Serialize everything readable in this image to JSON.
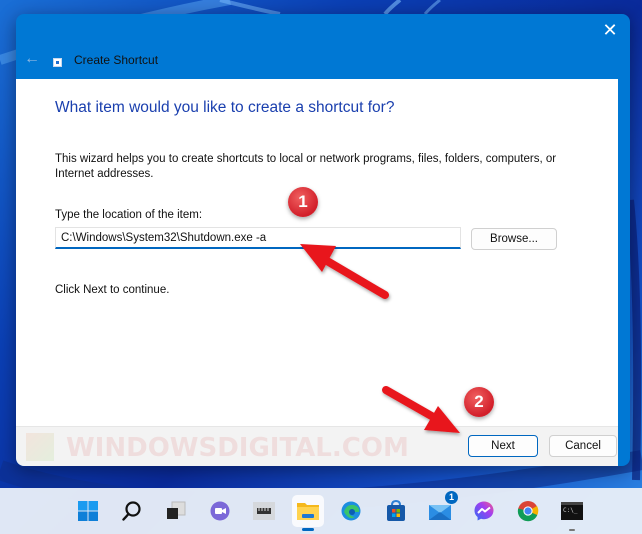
{
  "dialog": {
    "title": "Create Shortcut",
    "close_glyph": "✕",
    "back_glyph": "←",
    "heading": "What item would you like to create a shortcut for?",
    "description": "This wizard helps you to create shortcuts to local or network programs, files, folders, computers, or Internet addresses.",
    "location_label": "Type the location of the item:",
    "location_value": "C:\\Windows\\System32\\Shutdown.exe -a",
    "browse_label": "Browse...",
    "continue_text": "Click Next to continue.",
    "next_label": "Next",
    "cancel_label": "Cancel",
    "accent_color": "#0078d4",
    "heading_color": "#1a3fae"
  },
  "annotations": {
    "callout_1": "1",
    "callout_2": "2",
    "arrow_color": "#e8141c",
    "watermark": "WindowsDigital.com"
  },
  "taskbar": {
    "items": [
      {
        "name": "start",
        "icon": "windows-logo-icon"
      },
      {
        "name": "search",
        "icon": "search-icon"
      },
      {
        "name": "task-view",
        "icon": "task-view-icon"
      },
      {
        "name": "chat",
        "icon": "teams-chat-icon"
      },
      {
        "name": "widgets",
        "icon": "widgets-icon"
      },
      {
        "name": "file-explorer",
        "icon": "folder-icon",
        "active": true
      },
      {
        "name": "edge",
        "icon": "edge-icon"
      },
      {
        "name": "store",
        "icon": "store-icon"
      },
      {
        "name": "mail",
        "icon": "mail-icon",
        "badge": "1"
      },
      {
        "name": "messenger",
        "icon": "messenger-icon"
      },
      {
        "name": "chrome",
        "icon": "chrome-icon"
      },
      {
        "name": "terminal",
        "icon": "terminal-icon",
        "running": true
      }
    ]
  }
}
